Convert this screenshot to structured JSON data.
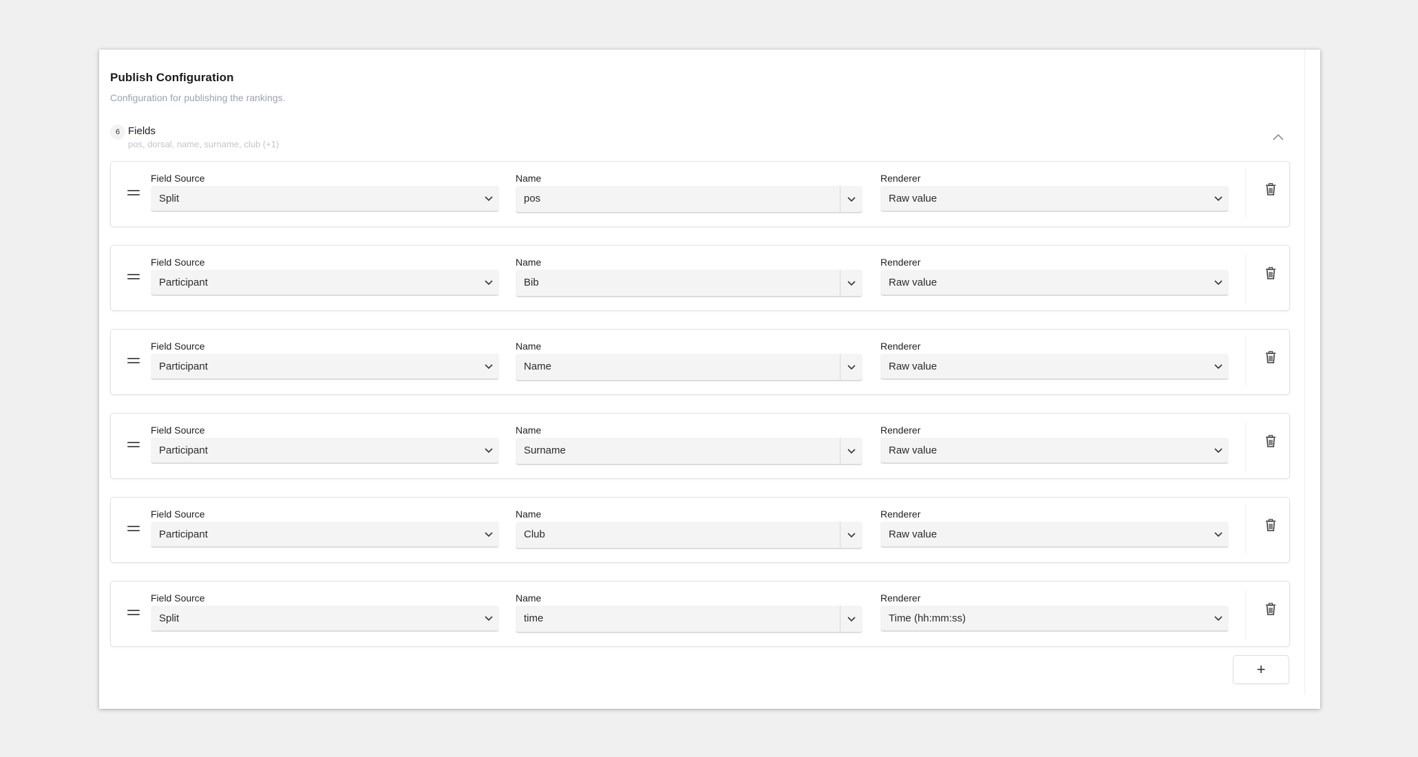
{
  "section": {
    "title": "Publish Configuration",
    "subtitle": "Configuration for publishing the rankings."
  },
  "fields": {
    "count": "6",
    "label": "Fields",
    "summary": "pos, dorsal, name, surname, club (+1)",
    "collapse_icon": "chevron-up-icon"
  },
  "labels": {
    "field_source": "Field Source",
    "name": "Name",
    "renderer": "Renderer"
  },
  "rows": [
    {
      "source": "Split",
      "name": "pos",
      "renderer": "Raw value"
    },
    {
      "source": "Participant",
      "name": "Bib",
      "renderer": "Raw value"
    },
    {
      "source": "Participant",
      "name": "Name",
      "renderer": "Raw value"
    },
    {
      "source": "Participant",
      "name": "Surname",
      "renderer": "Raw value"
    },
    {
      "source": "Participant",
      "name": "Club",
      "renderer": "Raw value"
    },
    {
      "source": "Split",
      "name": "time",
      "renderer": "Time (hh:mm:ss)"
    }
  ],
  "icons": {
    "drag": "drag-handle-icon",
    "delete": "trash-icon",
    "dropdown": "chevron-down-icon",
    "add": "plus-icon"
  },
  "add_button": {
    "label": "+"
  }
}
